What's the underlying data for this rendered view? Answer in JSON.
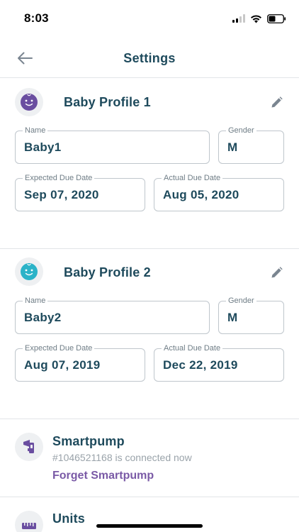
{
  "status": {
    "time": "8:03"
  },
  "header": {
    "title": "Settings"
  },
  "profiles": [
    {
      "title": "Baby Profile 1",
      "avatar_color": "#6a4ea0",
      "name_label": "Name",
      "name_value": "Baby1",
      "gender_label": "Gender",
      "gender_value": "M",
      "expected_label": "Expected Due Date",
      "expected_value": "Sep 07, 2020",
      "actual_label": "Actual Due Date",
      "actual_value": "Aug 05, 2020"
    },
    {
      "title": "Baby Profile 2",
      "avatar_color": "#2bb3c8",
      "name_label": "Name",
      "name_value": "Baby2",
      "gender_label": "Gender",
      "gender_value": "M",
      "expected_label": "Expected Due Date",
      "expected_value": "Aug 07, 2019",
      "actual_label": "Actual Due Date",
      "actual_value": "Dec 22, 2019"
    }
  ],
  "smartpump": {
    "title": "Smartpump",
    "status": "#1046521168 is connected now",
    "forget_label": "Forget Smartpump"
  },
  "units": {
    "title": "Units"
  },
  "colors": {
    "primary_text": "#1e4a5c",
    "accent": "#7a5aa6",
    "border": "#bfc6cc"
  }
}
